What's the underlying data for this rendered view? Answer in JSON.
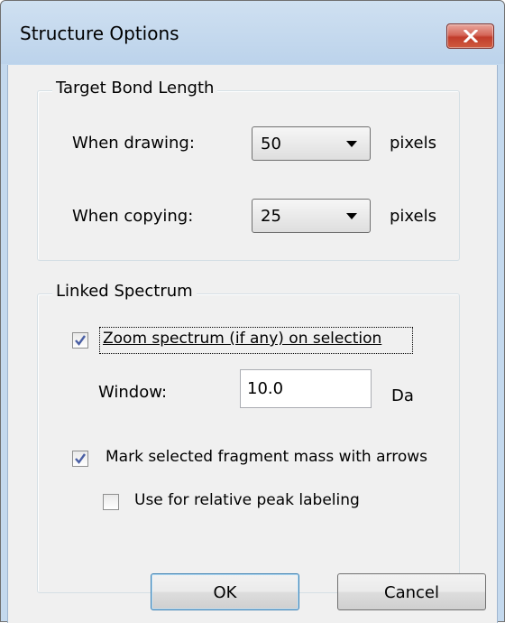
{
  "window": {
    "title": "Structure Options",
    "close_icon": "close-icon"
  },
  "target_bond_length": {
    "legend": "Target Bond Length",
    "drawing": {
      "label": "When drawing:",
      "value": "50",
      "unit": "pixels"
    },
    "copying": {
      "label": "When copying:",
      "value": "25",
      "unit": "pixels"
    }
  },
  "linked_spectrum": {
    "legend": "Linked Spectrum",
    "zoom": {
      "label": "Zoom spectrum (if any) on selection",
      "checked": true
    },
    "window": {
      "label": "Window:",
      "value": "10.0",
      "unit": "Da"
    },
    "mark_arrows": {
      "label": "Mark selected fragment mass with arrows",
      "checked": true
    },
    "relative_peak": {
      "label": "Use for relative peak labeling",
      "checked": false
    }
  },
  "buttons": {
    "ok": "OK",
    "cancel": "Cancel"
  },
  "colors": {
    "title_bar": "#c4d9ee",
    "close_button": "#c13d2c",
    "dialog_body": "#f0f0f0",
    "checkmark": "#4a5fa4"
  }
}
